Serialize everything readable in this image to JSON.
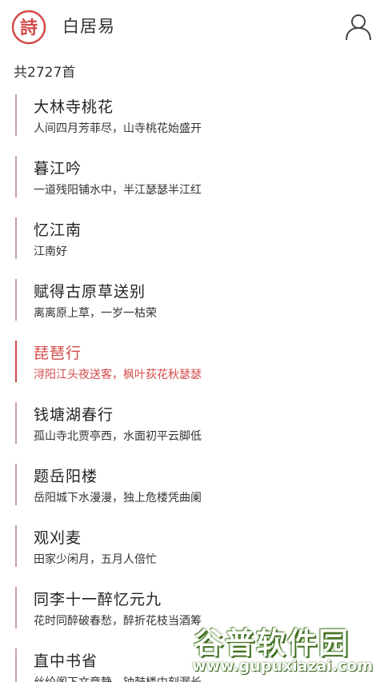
{
  "header": {
    "logo_char": "詩",
    "author_name": "白居易",
    "user_icon": "user-icon",
    "accent_color": "#d24a48"
  },
  "count_text": "共2727首",
  "poems": [
    {
      "title": "大林寺桃花",
      "line": "人间四月芳菲尽，山寺桃花始盛开",
      "active": false
    },
    {
      "title": "暮江吟",
      "line": "一道残阳铺水中，半江瑟瑟半江红",
      "active": false
    },
    {
      "title": "忆江南",
      "line": "江南好",
      "active": false
    },
    {
      "title": "赋得古原草送别",
      "line": "离离原上草，一岁一枯荣",
      "active": false
    },
    {
      "title": "琵琶行",
      "line": "浔阳江头夜送客，枫叶荻花秋瑟瑟",
      "active": true
    },
    {
      "title": "钱塘湖春行",
      "line": "孤山寺北贾亭西，水面初平云脚低",
      "active": false
    },
    {
      "title": "题岳阳楼",
      "line": "岳阳城下水漫漫，独上危楼凭曲阑",
      "active": false
    },
    {
      "title": "观刈麦",
      "line": "田家少闲月，五月人倍忙",
      "active": false
    },
    {
      "title": "同李十一醉忆元九",
      "line": "花时同醉破春愁，醉折花枝当酒筹",
      "active": false
    },
    {
      "title": "直中书省",
      "line": "丝纶阁下文章静，钟鼓楼中刻漏长",
      "active": false
    }
  ],
  "watermark": {
    "brand": "谷普软件园",
    "url": "www.gupuxiazai.com"
  }
}
